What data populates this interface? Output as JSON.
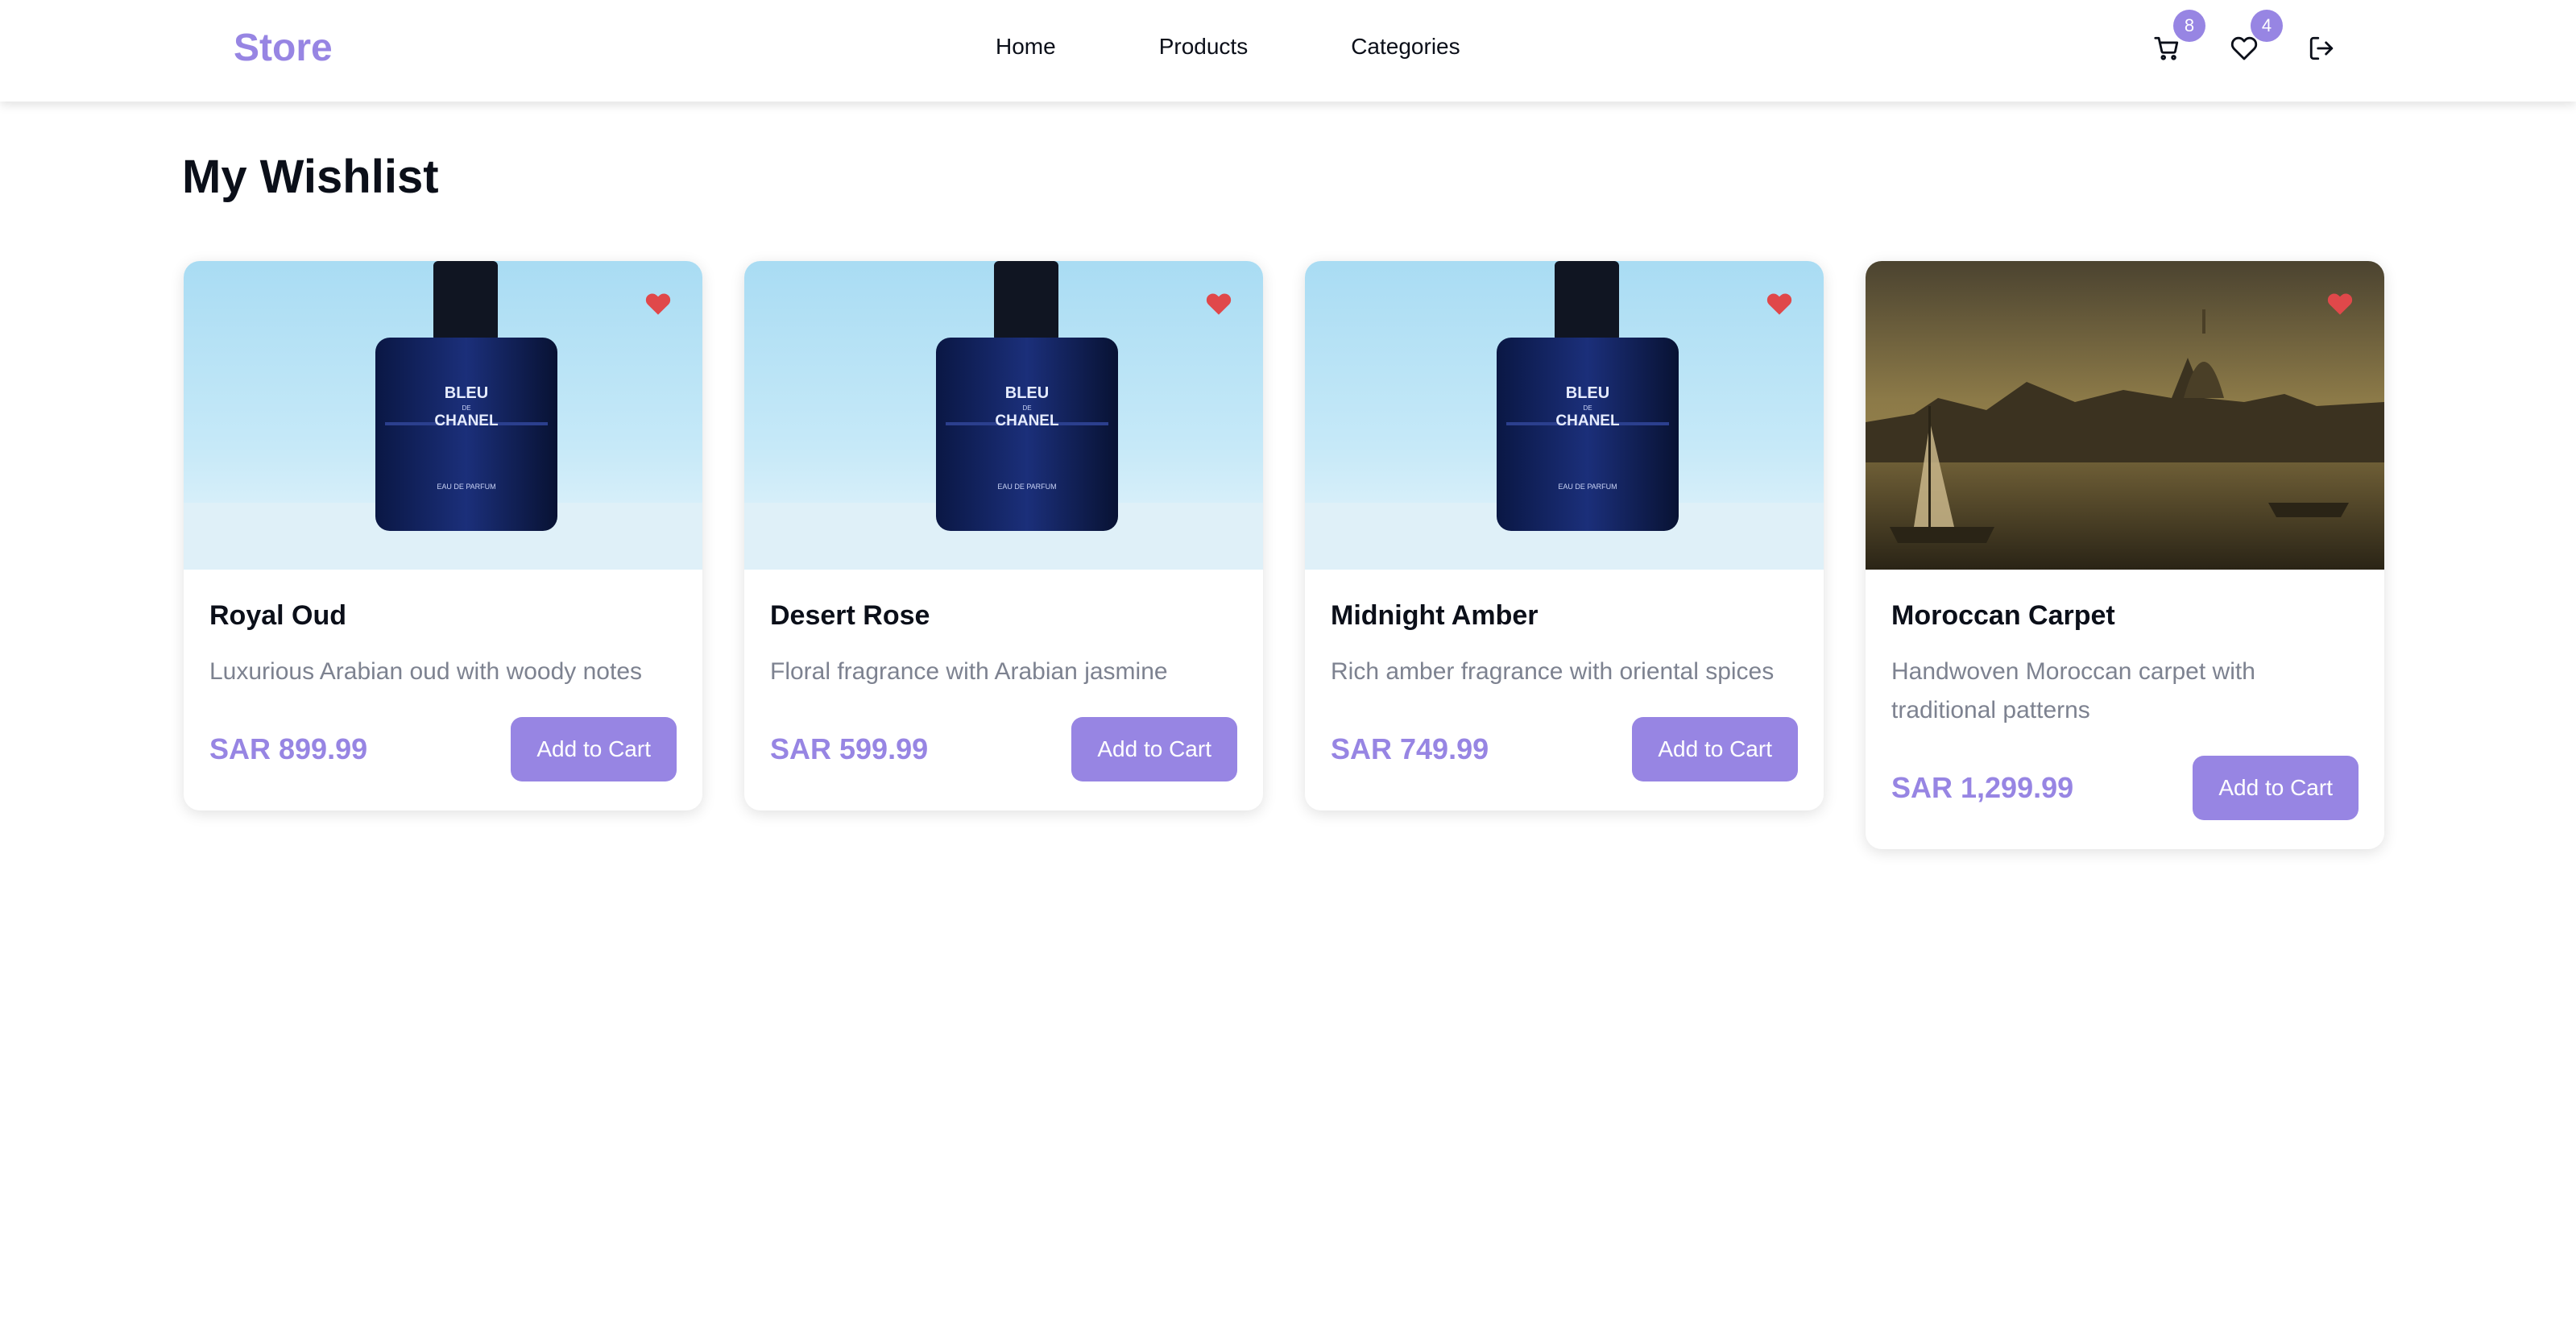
{
  "nav": {
    "brand": "Store",
    "links": [
      "Home",
      "Products",
      "Categories"
    ],
    "cart_count": "8",
    "wishlist_count": "4"
  },
  "page": {
    "title": "My Wishlist"
  },
  "colors": {
    "accent": "#9785e3",
    "heart": "#e0484a"
  },
  "wishlist": [
    {
      "name": "Royal Oud",
      "description": "Luxurious Arabian oud with woody notes",
      "price": "SAR 899.99",
      "button": "Add to Cart",
      "image": "perfume-bottle"
    },
    {
      "name": "Desert Rose",
      "description": "Floral fragrance with Arabian jasmine",
      "price": "SAR 599.99",
      "button": "Add to Cart",
      "image": "perfume-bottle"
    },
    {
      "name": "Midnight Amber",
      "description": "Rich amber fragrance with oriental spices",
      "price": "SAR 749.99",
      "button": "Add to Cart",
      "image": "perfume-bottle"
    },
    {
      "name": "Moroccan Carpet",
      "description": "Handwoven Moroccan carpet with traditional patterns",
      "price": "SAR 1,299.99",
      "button": "Add to Cart",
      "image": "harbor-painting"
    }
  ],
  "perfume_label": {
    "line1": "BLEU",
    "line2": "DE",
    "line3": "CHANEL",
    "line4": "EAU DE PARFUM"
  }
}
